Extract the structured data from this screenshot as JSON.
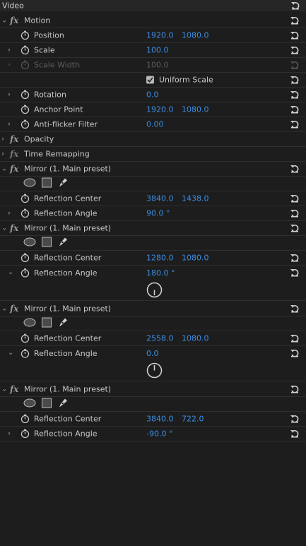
{
  "panel": {
    "title": "Video"
  },
  "icons": {
    "fx": "fx",
    "stopwatch": "stopwatch-icon",
    "reset": "reset-icon",
    "ellipse": "ellipse-mask-icon",
    "rect": "rectangle-mask-icon",
    "pen": "pen-mask-icon"
  },
  "motion": {
    "label": "Motion",
    "position": {
      "label": "Position",
      "x": "1920.0",
      "y": "1080.0"
    },
    "scale": {
      "label": "Scale",
      "value": "100.0"
    },
    "scale_width": {
      "label": "Scale Width",
      "value": "100.0"
    },
    "uniform_scale": {
      "label": "Uniform Scale",
      "checked": true
    },
    "rotation": {
      "label": "Rotation",
      "value": "0.0"
    },
    "anchor_point": {
      "label": "Anchor Point",
      "x": "1920.0",
      "y": "1080.0"
    },
    "anti_flicker": {
      "label": "Anti-flicker Filter",
      "value": "0.00"
    }
  },
  "opacity": {
    "label": "Opacity"
  },
  "time_remapping": {
    "label": "Time Remapping"
  },
  "mirrors": [
    {
      "title": "Mirror (1. Main preset)",
      "center_label": "Reflection Center",
      "center_x": "3840.0",
      "center_y": "1438.0",
      "angle_label": "Reflection Angle",
      "angle": "90.0 °",
      "expanded": false
    },
    {
      "title": "Mirror (1. Main preset)",
      "center_label": "Reflection Center",
      "center_x": "1280.0",
      "center_y": "1080.0",
      "angle_label": "Reflection Angle",
      "angle": "180.0 °",
      "expanded": true
    },
    {
      "title": "Mirror (1. Main preset)",
      "center_label": "Reflection Center",
      "center_x": "2558.0",
      "center_y": "1080.0",
      "angle_label": "Reflection Angle",
      "angle": "0.0",
      "expanded": true
    },
    {
      "title": "Mirror (1. Main preset)",
      "center_label": "Reflection Center",
      "center_x": "3840.0",
      "center_y": "722.0",
      "angle_label": "Reflection Angle",
      "angle": "-90.0 °",
      "expanded": false
    }
  ],
  "colors": {
    "value_blue": "#3a8ee6",
    "panel_bg": "#1d1d1d",
    "header_bg": "#262626"
  }
}
